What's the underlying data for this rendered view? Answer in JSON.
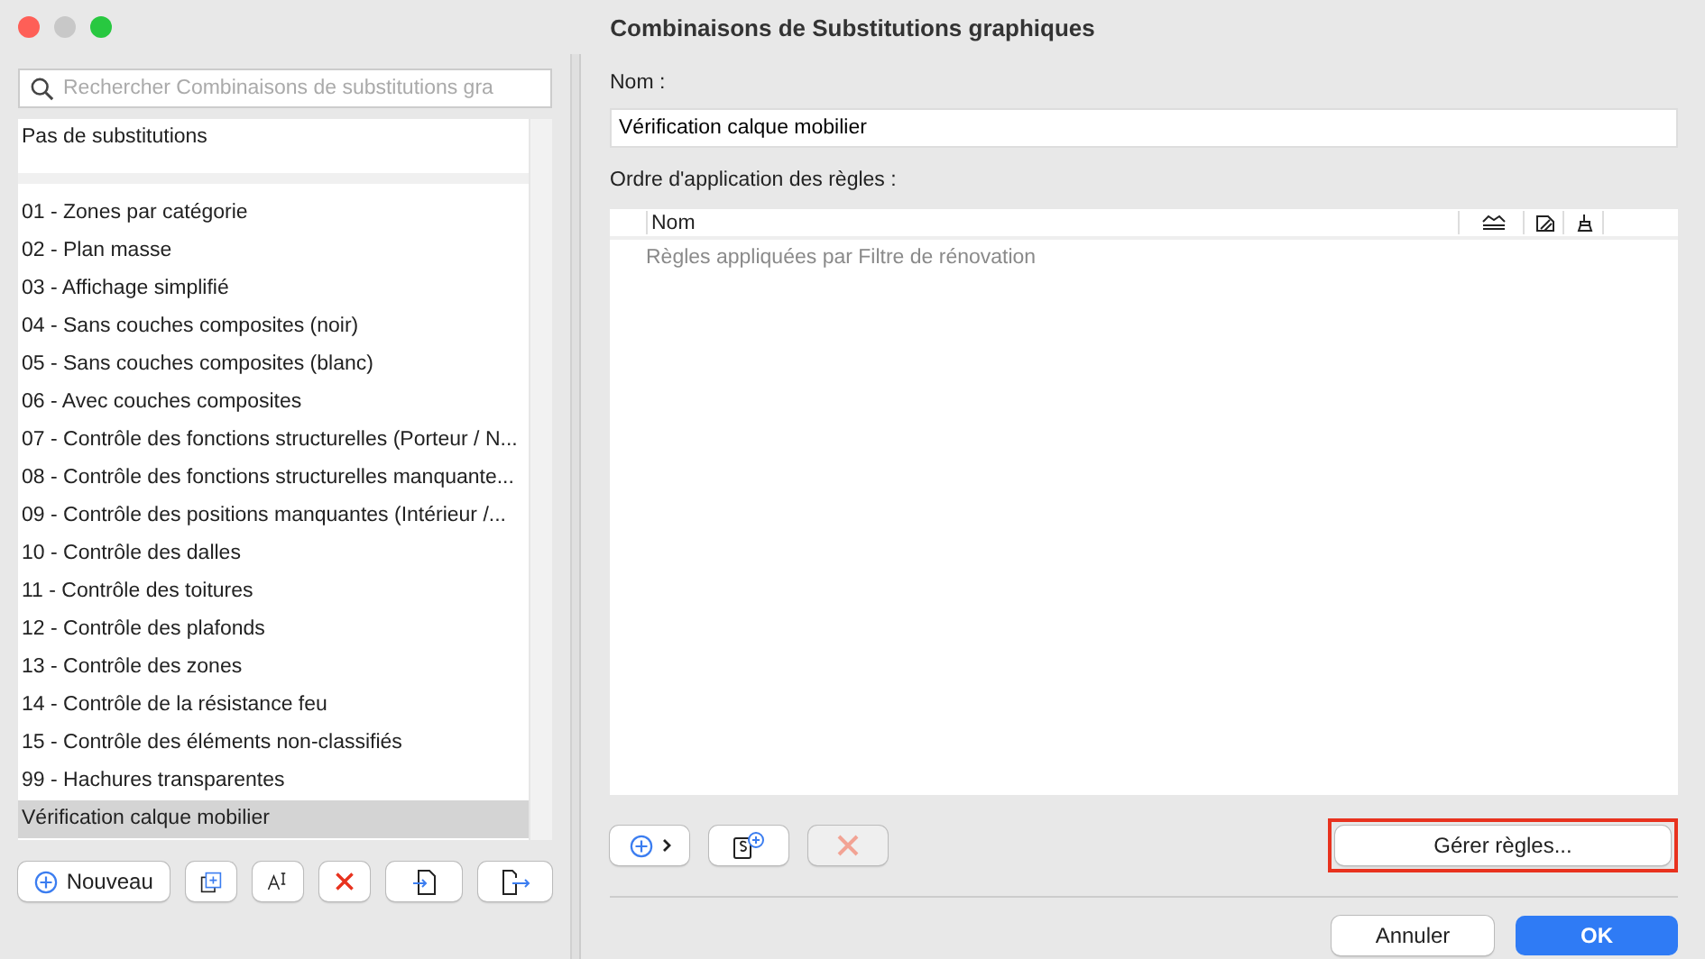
{
  "window": {
    "title": "Combinaisons de Substitutions graphiques"
  },
  "search": {
    "placeholder": "Rechercher Combinaisons de substitutions gra"
  },
  "default_item": {
    "label": "Pas de substitutions",
    "selected": false
  },
  "items": [
    {
      "label": "01 - Zones par catégorie",
      "selected": false
    },
    {
      "label": "02 - Plan masse",
      "selected": false
    },
    {
      "label": "03 - Affichage simplifié",
      "selected": false
    },
    {
      "label": "04 - Sans couches composites (noir)",
      "selected": false
    },
    {
      "label": "05 - Sans couches composites (blanc)",
      "selected": false
    },
    {
      "label": "06 - Avec couches composites",
      "selected": false
    },
    {
      "label": "07 - Contrôle des fonctions structurelles (Porteur / N...",
      "selected": false
    },
    {
      "label": "08 - Contrôle des fonctions structurelles manquante...",
      "selected": false
    },
    {
      "label": "09 - Contrôle des positions manquantes (Intérieur /...",
      "selected": false
    },
    {
      "label": "10 - Contrôle des dalles",
      "selected": false
    },
    {
      "label": "11 - Contrôle des toitures",
      "selected": false
    },
    {
      "label": "12 - Contrôle des plafonds",
      "selected": false
    },
    {
      "label": "13 - Contrôle des zones",
      "selected": false
    },
    {
      "label": "14 - Contrôle de la résistance feu",
      "selected": false
    },
    {
      "label": "15 - Contrôle des éléments non-classifiés",
      "selected": false
    },
    {
      "label": "99 - Hachures transparentes",
      "selected": false
    },
    {
      "label": "Vérification calque mobilier",
      "selected": true
    }
  ],
  "left_buttons": {
    "new": "Nouveau"
  },
  "name_field": {
    "label": "Nom :",
    "value": "Vérification calque mobilier"
  },
  "rules": {
    "label": "Ordre d'application des règles :",
    "columns": [
      "Nom"
    ],
    "rows": [
      {
        "label": "Règles appliquées par Filtre de rénovation",
        "disabled": true
      }
    ]
  },
  "rule_buttons": {
    "delete_disabled": true
  },
  "manage_button": {
    "label": "Gérer règles...",
    "highlighted": true
  },
  "footer": {
    "cancel": "Annuler",
    "ok": "OK"
  }
}
